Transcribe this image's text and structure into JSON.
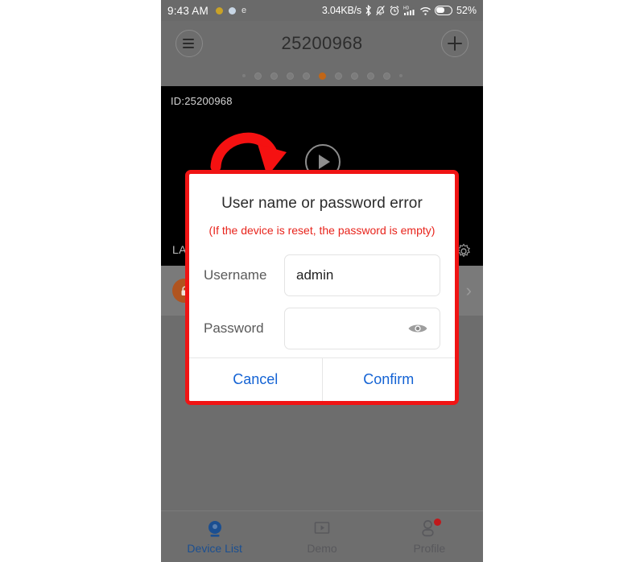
{
  "status_bar": {
    "time": "9:43 AM",
    "network_speed": "3.04KB/s",
    "battery_percent": "52%",
    "icons": [
      "notification-dot-yellow",
      "notification-dot-blue",
      "email-icon",
      "bluetooth-icon",
      "mute-bell-icon",
      "alarm-clock-icon",
      "hd-signal-icon",
      "wifi-icon",
      "battery-icon"
    ]
  },
  "app_bar": {
    "menu_icon": "hamburger-list-icon",
    "title": "25200968",
    "add_icon": "plus-icon"
  },
  "pager": {
    "total_dots": 9,
    "active_index": 5,
    "active_color": "#c26617"
  },
  "video_card": {
    "id_label": "ID:25200968",
    "play_icon": "play-circle-icon",
    "annotation_icon": "red-curved-arrow",
    "bottom_label": "LAN",
    "settings_icon": "gear-icon"
  },
  "device_row": {
    "avatar_icon": "camera-lock-icon",
    "chevron_icon": "chevron-right-icon"
  },
  "dialog": {
    "title": "User name or password error",
    "subtitle": "(If the device is reset, the password is empty)",
    "border_color": "#f01414",
    "fields": [
      {
        "label": "Username",
        "value": "admin",
        "placeholder": ""
      },
      {
        "label": "Password",
        "value": "",
        "placeholder": "",
        "trailing_icon": "eye-icon"
      }
    ],
    "cancel_label": "Cancel",
    "confirm_label": "Confirm",
    "action_color": "#1463d4"
  },
  "bottom_nav": {
    "items": [
      {
        "label": "Device List",
        "icon": "camera-icon",
        "active": true
      },
      {
        "label": "Demo",
        "icon": "video-play-icon",
        "active": false
      },
      {
        "label": "Profile",
        "icon": "person-icon",
        "active": false,
        "badge": true
      }
    ],
    "active_color": "#1b4f91"
  }
}
